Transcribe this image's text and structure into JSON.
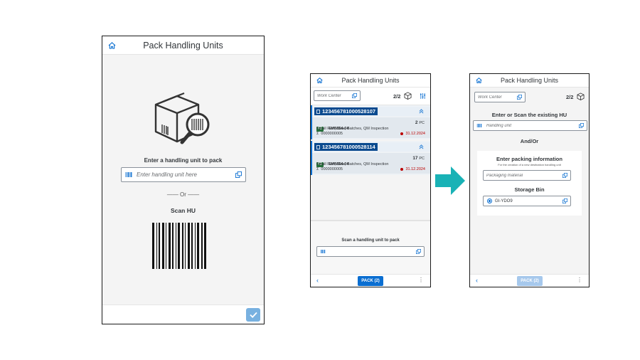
{
  "colors": {
    "accent": "#0a6ed1",
    "hu_tag": "#0a4a8f",
    "arrow": "#19b2b6",
    "ok_button": "#78b1e0",
    "date": "#bb0000",
    "tag_green": "#256f3a"
  },
  "screen1": {
    "title": "Pack Handling Units",
    "home_icon": "home-icon",
    "illustration": "box-with-magnifier-barcode",
    "prompt": "Enter a handling unit to pack",
    "input_placeholder": "Enter handling unit here",
    "or_text": "—— Or ——",
    "scan_label": "Scan HU",
    "confirm_icon": "checkmark-icon"
  },
  "screen2": {
    "title": "Pack Handling Units",
    "work_center_placeholder": "Work Center",
    "count": "2/2",
    "handling_units": [
      {
        "id": "123456781000528107",
        "product": "EWMS4-04",
        "tag": "F2",
        "description": "Small Part, Slow, Batches, QM Inspection",
        "batch": "0000000005",
        "quantity": "2",
        "unit": "PC",
        "date": "31.12.2024"
      },
      {
        "id": "123456781000528114",
        "product": "EWMS4-04",
        "tag": "F2",
        "description": "Small Part, Slow, Batches, QM Inspection",
        "batch": "0000000005",
        "quantity": "17",
        "unit": "PC",
        "date": "31.12.2024"
      }
    ],
    "scan_label": "Scan a handling unit to pack",
    "pack_button": "PACK (2)"
  },
  "screen3": {
    "title": "Pack Handling Units",
    "work_center_placeholder": "Work Center",
    "count": "2/2",
    "existing_hu_label": "Enter or Scan the existing HU",
    "handling_unit_placeholder": "Handling unit",
    "and_or": "And/Or",
    "packing_info_title": "Enter packing information",
    "packing_info_subtitle": "For the creation of a new destination handling unit",
    "packaging_material_placeholder": "Packaging material",
    "storage_bin_label": "Storage Bin",
    "storage_bin_value": "GI-YDO9",
    "pack_button": "PACK (2)"
  }
}
